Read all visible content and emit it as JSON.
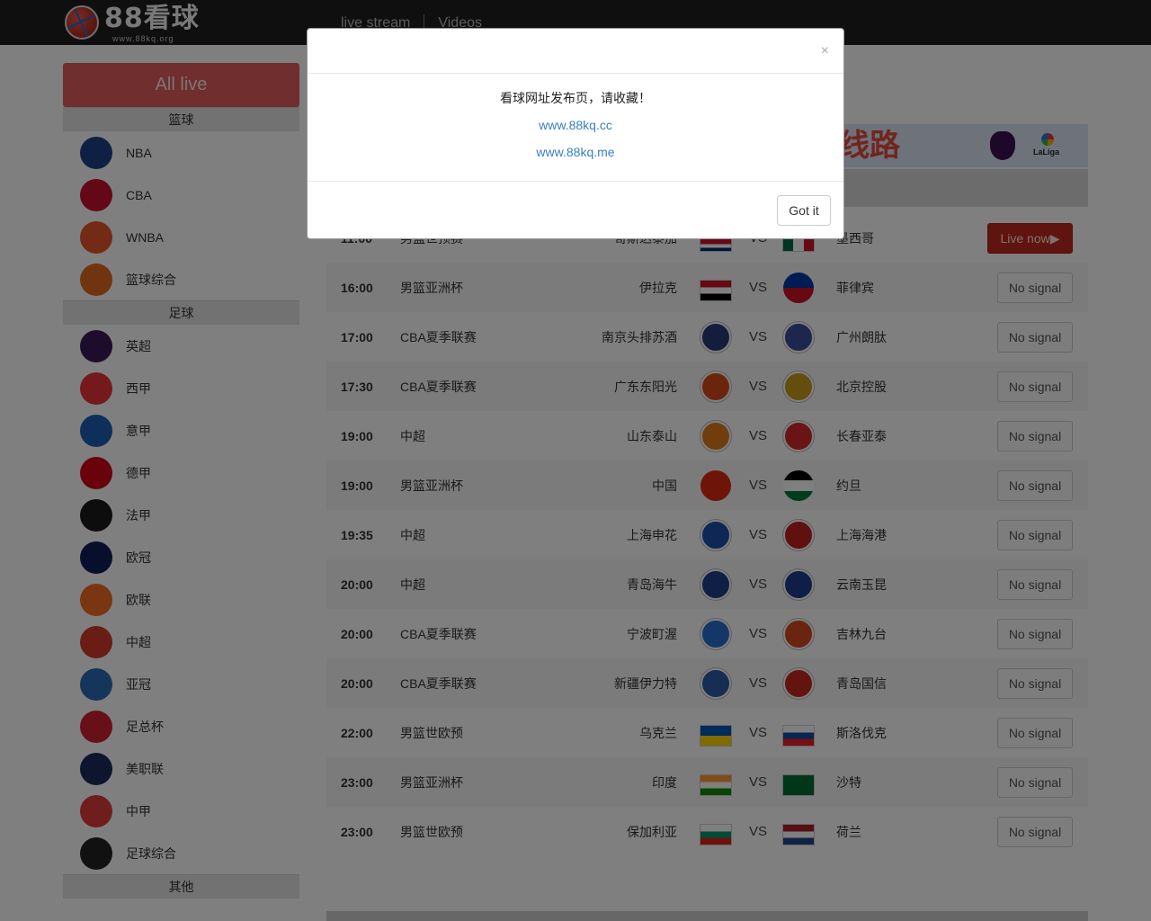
{
  "header": {
    "logo_text": "88看球",
    "logo_url": "www.88kq.org",
    "nav": [
      "live stream",
      "Videos"
    ]
  },
  "sidebar": {
    "all_live_label": "All live",
    "categories": [
      {
        "title": "篮球",
        "items": [
          {
            "label": "NBA",
            "icon": "nba-icon",
            "color": "#1d428a"
          },
          {
            "label": "CBA",
            "icon": "cba-icon",
            "color": "#c8102e"
          },
          {
            "label": "WNBA",
            "icon": "wnba-icon",
            "color": "#e8562a"
          },
          {
            "label": "篮球综合",
            "icon": "basketball-icon",
            "color": "#e06a1f"
          }
        ]
      },
      {
        "title": "足球",
        "items": [
          {
            "label": "英超",
            "icon": "premier-league-icon",
            "color": "#3d195b"
          },
          {
            "label": "西甲",
            "icon": "laliga-icon",
            "color": "#e8343b"
          },
          {
            "label": "意甲",
            "icon": "serie-a-icon",
            "color": "#1b5fb3"
          },
          {
            "label": "德甲",
            "icon": "bundesliga-icon",
            "color": "#d20515"
          },
          {
            "label": "法甲",
            "icon": "ligue1-icon",
            "color": "#1a1a1a"
          },
          {
            "label": "欧冠",
            "icon": "champions-league-icon",
            "color": "#0e1e5b"
          },
          {
            "label": "欧联",
            "icon": "europa-league-icon",
            "color": "#f36c21"
          },
          {
            "label": "中超",
            "icon": "csl-icon",
            "color": "#d23b2b"
          },
          {
            "label": "亚冠",
            "icon": "afc-champions-icon",
            "color": "#2a6db5"
          },
          {
            "label": "足总杯",
            "icon": "fa-cup-icon",
            "color": "#cf2030"
          },
          {
            "label": "美职联",
            "icon": "mls-icon",
            "color": "#1a2a5e"
          },
          {
            "label": "中甲",
            "icon": "china-league-one-icon",
            "color": "#e03a3a"
          },
          {
            "label": "足球综合",
            "icon": "soccer-ball-icon",
            "color": "#222222"
          }
        ]
      },
      {
        "title": "其他",
        "items": []
      }
    ]
  },
  "banner": {
    "text": "线路"
  },
  "matches": [
    {
      "time": "11:00",
      "league": "男篮世预赛",
      "home": "哥斯达黎加",
      "away": "墨西哥",
      "status": "Live now▶",
      "live": true,
      "home_icon": "costa-rica-flag-icon",
      "away_icon": "mexico-flag-icon"
    },
    {
      "time": "16:00",
      "league": "男篮亚洲杯",
      "home": "伊拉克",
      "away": "菲律宾",
      "status": "No signal",
      "live": false,
      "home_icon": "iraq-flag-icon",
      "away_icon": "philippines-flag-icon"
    },
    {
      "time": "17:00",
      "league": "CBA夏季联赛",
      "home": "南京头排苏酒",
      "away": "广州朗肽",
      "status": "No signal",
      "live": false,
      "home_icon": "nanjing-crest-icon",
      "away_icon": "guangzhou-crest-icon"
    },
    {
      "time": "17:30",
      "league": "CBA夏季联赛",
      "home": "广东东阳光",
      "away": "北京控股",
      "status": "No signal",
      "live": false,
      "home_icon": "guangdong-crest-icon",
      "away_icon": "beijing-crest-icon"
    },
    {
      "time": "19:00",
      "league": "中超",
      "home": "山东泰山",
      "away": "长春亚泰",
      "status": "No signal",
      "live": false,
      "home_icon": "shandong-crest-icon",
      "away_icon": "changchun-crest-icon"
    },
    {
      "time": "19:00",
      "league": "男篮亚洲杯",
      "home": "中国",
      "away": "约旦",
      "status": "No signal",
      "live": false,
      "home_icon": "china-flag-icon",
      "away_icon": "jordan-flag-icon"
    },
    {
      "time": "19:35",
      "league": "中超",
      "home": "上海申花",
      "away": "上海海港",
      "status": "No signal",
      "live": false,
      "home_icon": "shenhua-crest-icon",
      "away_icon": "haigang-crest-icon"
    },
    {
      "time": "20:00",
      "league": "中超",
      "home": "青岛海牛",
      "away": "云南玉昆",
      "status": "No signal",
      "live": false,
      "home_icon": "qingdao-hainiu-crest-icon",
      "away_icon": "yunnan-crest-icon"
    },
    {
      "time": "20:00",
      "league": "CBA夏季联赛",
      "home": "宁波町渥",
      "away": "吉林九台",
      "status": "No signal",
      "live": false,
      "home_icon": "ningbo-crest-icon",
      "away_icon": "jilin-crest-icon"
    },
    {
      "time": "20:00",
      "league": "CBA夏季联赛",
      "home": "新疆伊力特",
      "away": "青岛国信",
      "status": "No signal",
      "live": false,
      "home_icon": "xinjiang-crest-icon",
      "away_icon": "qingdao-guoxin-crest-icon"
    },
    {
      "time": "22:00",
      "league": "男篮世欧预",
      "home": "乌克兰",
      "away": "斯洛伐克",
      "status": "No signal",
      "live": false,
      "home_icon": "ukraine-flag-icon",
      "away_icon": "slovakia-flag-icon"
    },
    {
      "time": "23:00",
      "league": "男篮亚洲杯",
      "home": "印度",
      "away": "沙特",
      "status": "No signal",
      "live": false,
      "home_icon": "india-flag-icon",
      "away_icon": "saudi-flag-icon"
    },
    {
      "time": "23:00",
      "league": "男篮世欧预",
      "home": "保加利亚",
      "away": "荷兰",
      "status": "No signal",
      "live": false,
      "home_icon": "bulgaria-flag-icon",
      "away_icon": "netherlands-flag-icon"
    }
  ],
  "modal": {
    "close_glyph": "×",
    "message": "看球网址发布页，请收藏！",
    "links": [
      "www.88kq.cc",
      "www.88kq.me"
    ],
    "ok_label": "Got it"
  },
  "colors": {
    "live_button": "#c0281e",
    "all_live": "#e05d5d",
    "topbar": "#1e1e1e",
    "link": "#3a7fc4"
  }
}
